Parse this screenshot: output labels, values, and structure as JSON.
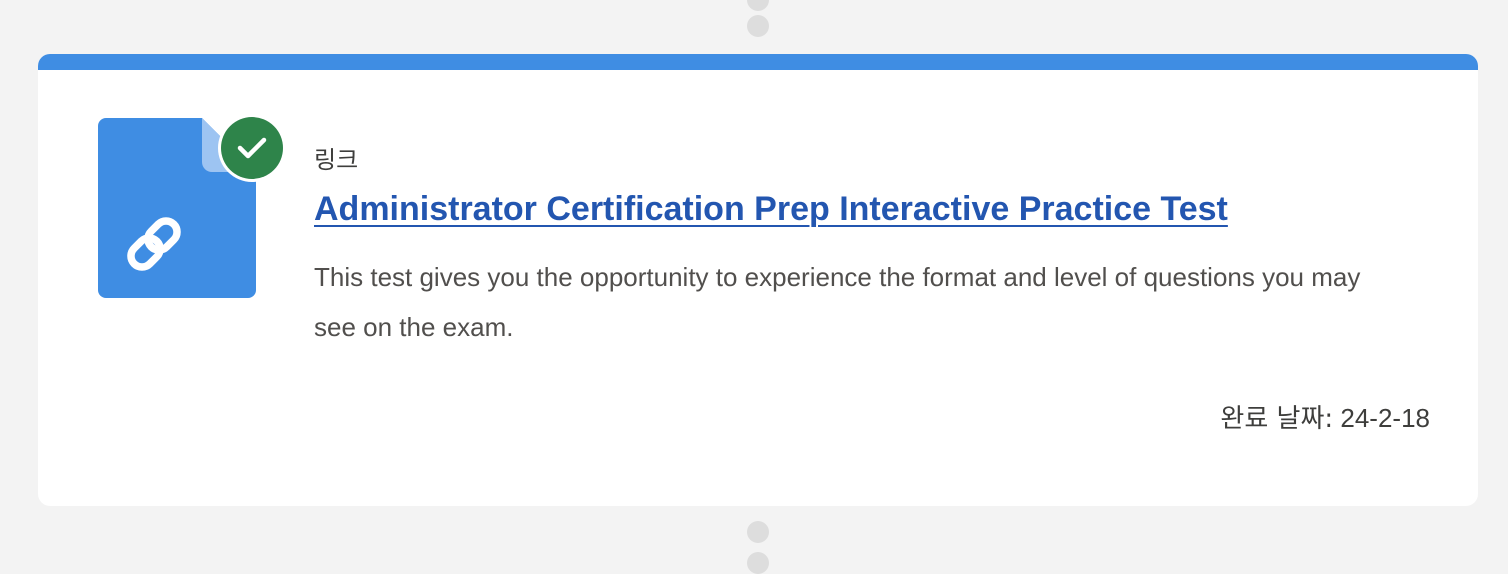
{
  "item": {
    "type_label": "링크",
    "title": "Administrator Certification Prep Interactive Practice Test",
    "description": "This test gives you the opportunity to experience the format and level of questions you may see on the exam.",
    "completion_label": "완료 날짜:",
    "completion_date": "24-2-18"
  },
  "icons": {
    "document": "link-document-icon",
    "status": "check-icon"
  },
  "colors": {
    "accent": "#3f8de3",
    "link": "#2356b0",
    "success": "#2e844a"
  }
}
